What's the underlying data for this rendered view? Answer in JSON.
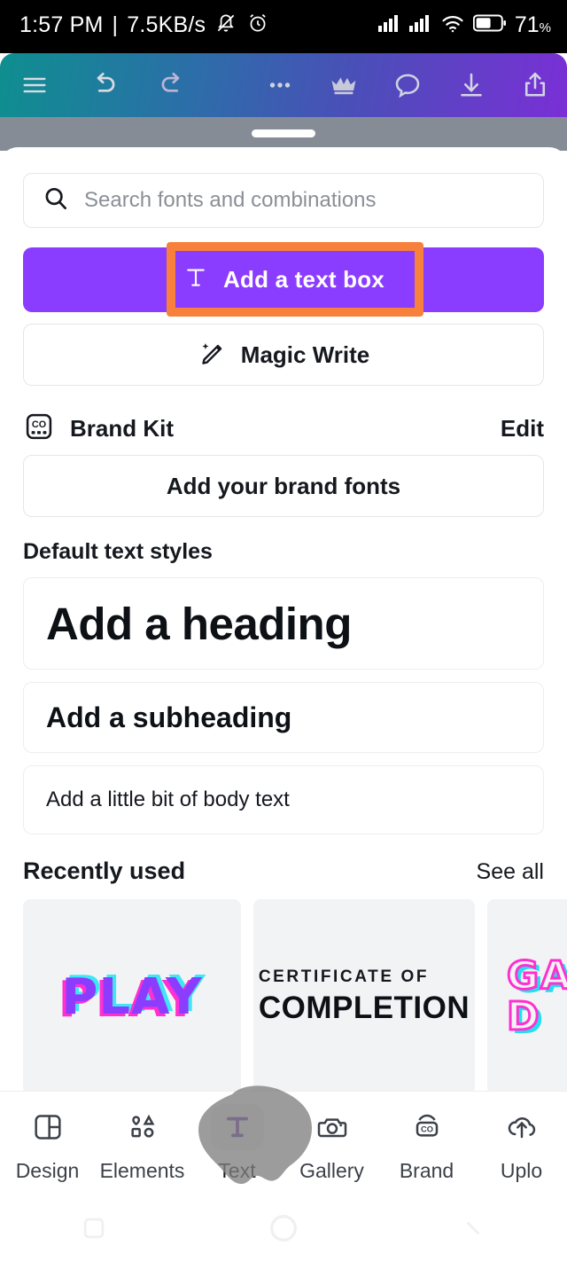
{
  "status_bar": {
    "time": "1:57 PM",
    "separator": "|",
    "network_speed": "7.5KB/s",
    "mute_icon": "bell-muted-icon",
    "alarm_icon": "alarm-clock-icon",
    "signal_icon_1": "signal-bars-icon",
    "signal_icon_2": "signal-bars-icon",
    "wifi_icon": "wifi-icon",
    "battery_icon": "battery-icon",
    "battery_percent": "71",
    "battery_unit": "%"
  },
  "toolbar": {
    "menu_icon": "hamburger-menu-icon",
    "undo_icon": "undo-icon",
    "redo_icon": "redo-icon",
    "more_icon": "more-horizontal-icon",
    "crown_icon": "crown-icon",
    "comment_icon": "comment-bubble-icon",
    "download_icon": "download-icon",
    "share_icon": "share-upload-icon",
    "gradient_start": "#0e8f8f",
    "gradient_end": "#7a2fd6"
  },
  "sheet": {
    "grabber": "drag-handle"
  },
  "search": {
    "icon": "search-icon",
    "placeholder": "Search fonts and combinations",
    "value": ""
  },
  "actions": {
    "add_text_box": {
      "label": "Add a text box",
      "icon": "text-tool-icon",
      "background": "#8b3dff",
      "text_color": "#ffffff"
    },
    "magic_write": {
      "label": "Magic Write",
      "icon": "magic-pen-icon"
    }
  },
  "annotation": {
    "type": "highlight-rectangle",
    "target": "Add a text box",
    "color": "#f7803c"
  },
  "brand_kit": {
    "icon": "brand-kit-icon",
    "title": "Brand Kit",
    "edit_label": "Edit",
    "add_fonts_label": "Add your brand fonts"
  },
  "default_text_styles": {
    "section_title": "Default text styles",
    "items": [
      {
        "label": "Add a heading",
        "style": "heading"
      },
      {
        "label": "Add a subheading",
        "style": "subheading"
      },
      {
        "label": "Add a little bit of body text",
        "style": "body"
      }
    ]
  },
  "recently_used": {
    "section_title": "Recently used",
    "see_all_label": "See all",
    "cards": [
      {
        "name": "play-text-style",
        "text": "PLAY",
        "style": "purple-blocky-chromatic"
      },
      {
        "name": "certificate-text-style",
        "line1": "CERTIFICATE OF",
        "line2": "COMPLETION",
        "style": "black-caps"
      },
      {
        "name": "neon-text-style",
        "line1": "GA",
        "line2": "D",
        "style": "neon-outline-magenta-cyan"
      }
    ]
  },
  "bottom_nav": {
    "items": [
      {
        "label": "Design",
        "icon": "layout-panels-icon",
        "active": false
      },
      {
        "label": "Elements",
        "icon": "shapes-icon",
        "active": false
      },
      {
        "label": "Text",
        "icon": "text-t-icon",
        "active": true
      },
      {
        "label": "Gallery",
        "icon": "camera-icon",
        "active": false
      },
      {
        "label": "Brand",
        "icon": "brand-co-icon",
        "active": false
      },
      {
        "label": "Uplo",
        "icon": "cloud-upload-icon",
        "active": false
      }
    ],
    "active_color": "#6b2fa8",
    "touch_blob": "finger-touch-overlay"
  },
  "android_nav": {
    "recents_icon": "square-recents-icon",
    "home_icon": "circle-home-icon",
    "back_icon": "chevron-back-icon"
  }
}
